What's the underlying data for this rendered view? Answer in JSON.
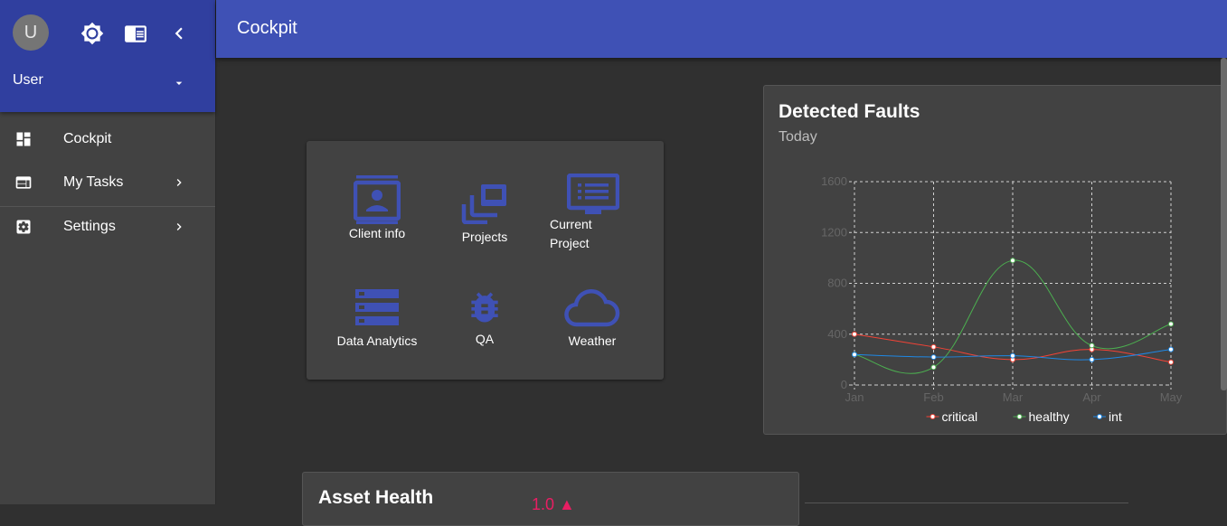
{
  "sidebar": {
    "avatar_initial": "U",
    "user_name": "User",
    "items": [
      {
        "label": "Cockpit"
      },
      {
        "label": "My Tasks"
      },
      {
        "label": "Settings"
      }
    ]
  },
  "topbar": {
    "title": "Cockpit"
  },
  "tiles": [
    {
      "label": "Client info",
      "icon": "client-info-icon"
    },
    {
      "label": "Projects",
      "icon": "projects-icon"
    },
    {
      "label": "Current Project",
      "icon": "monitor-icon"
    },
    {
      "label": "Data Analytics",
      "icon": "data-analytics-icon"
    },
    {
      "label": "QA",
      "icon": "bug-icon"
    },
    {
      "label": "Weather",
      "icon": "cloud-icon"
    }
  ],
  "chart_card": {
    "title": "Detected Faults",
    "subtitle": "Today"
  },
  "chart_data": {
    "type": "line",
    "categories": [
      "Jan",
      "Feb",
      "Mar",
      "Apr",
      "May"
    ],
    "ylim": [
      0,
      1600
    ],
    "yticks": [
      0,
      400,
      800,
      1200,
      1600
    ],
    "grid": true,
    "legend_position": "bottom",
    "series": [
      {
        "name": "critical",
        "color": "#f44336",
        "values": [
          400,
          300,
          200,
          280,
          180
        ]
      },
      {
        "name": "healthy",
        "color": "#4caf50",
        "values": [
          240,
          140,
          980,
          310,
          480
        ]
      },
      {
        "name": "int",
        "color": "#1e88e5",
        "values": [
          240,
          220,
          230,
          200,
          280
        ]
      }
    ]
  },
  "asset_card": {
    "title": "Asset Health",
    "value": "1.0 ▲"
  },
  "colors": {
    "primary": "#3f51b5",
    "primary_dark": "#303f9f",
    "tile_icon": "#3f51b5"
  }
}
